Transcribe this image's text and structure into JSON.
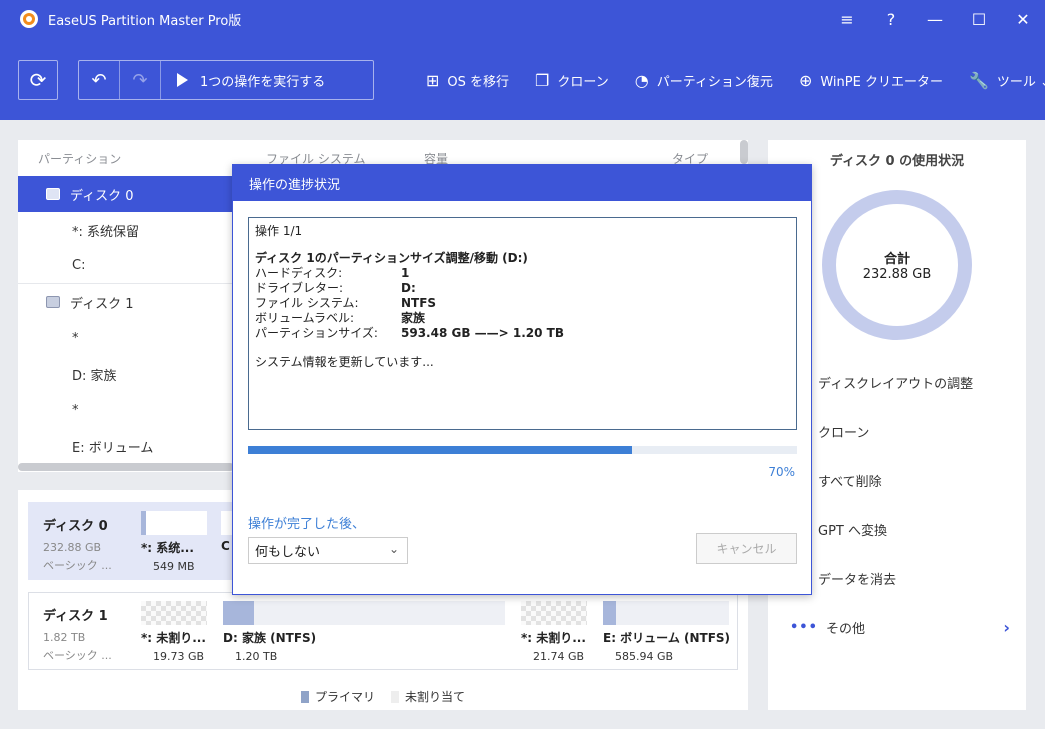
{
  "app": {
    "title": "EaseUS Partition Master Pro版"
  },
  "window_controls": {
    "menu": "≡",
    "help": "?",
    "minimize": "—",
    "maximize": "☐",
    "close": "✕"
  },
  "toolbar": {
    "refresh_icon": "⟳",
    "undo_icon": "↶",
    "redo_icon": "↷",
    "run_label": "1つの操作を実行する",
    "items": [
      {
        "icon": "windows-icon",
        "glyph": "⊞",
        "label": "OS を移行"
      },
      {
        "icon": "clone-icon",
        "glyph": "❐",
        "label": "クローン"
      },
      {
        "icon": "pie-recover-icon",
        "glyph": "◔",
        "label": "パーティション復元"
      },
      {
        "icon": "winpe-plus-icon",
        "glyph": "⊕",
        "label": "WinPE クリエーター"
      },
      {
        "icon": "tools-icon",
        "glyph": "🔧",
        "label": "ツール ⌄"
      }
    ]
  },
  "partition_list": {
    "headers": {
      "partition": "パーティション",
      "filesystem": "ファイル システム",
      "capacity": "容量",
      "type": "タイプ"
    },
    "rows": [
      {
        "label": "ディスク 0",
        "kind": "disk"
      },
      {
        "label": "*: 系统保留",
        "kind": "part"
      },
      {
        "label": "C:",
        "kind": "part"
      },
      {
        "label": "ディスク 1",
        "kind": "disk"
      },
      {
        "label": "*",
        "kind": "part"
      },
      {
        "label": "D: 家族",
        "kind": "part"
      },
      {
        "label": "*",
        "kind": "part"
      },
      {
        "label": "E: ボリューム",
        "kind": "part"
      }
    ]
  },
  "disk_map": {
    "disk0": {
      "name": "ディスク 0",
      "size": "232.88 GB",
      "type": "ベーシック ...",
      "partitions": [
        {
          "label": "*: 系统...",
          "size": "549 MB",
          "fill": 0.08
        },
        {
          "label": "C",
          "size": "",
          "fill": 0.0
        }
      ]
    },
    "disk1": {
      "name": "ディスク 1",
      "size": "1.82 TB",
      "type": "ベーシック ...",
      "partitions": [
        {
          "label": "*: 未割り...",
          "size": "19.73 GB",
          "unallocated": true
        },
        {
          "label": "D: 家族 (NTFS)",
          "size": "1.20 TB",
          "fill": 0.11
        },
        {
          "label": "*: 未割り...",
          "size": "21.74 GB",
          "unallocated": true
        },
        {
          "label": "E: ボリューム (NTFS)",
          "size": "585.94 GB",
          "fill": 0.1
        }
      ]
    },
    "legend": {
      "primary": "プライマリ",
      "unallocated": "未割り当て",
      "primary_color": "#8fa3c8"
    }
  },
  "right_panel": {
    "title": "ディスク 0 の使用状況",
    "total_label": "合計",
    "total_value": "232.88 GB",
    "actions": [
      "ディスクレイアウトの調整",
      "クローン",
      "すべて削除",
      "GPT へ変換",
      "データを消去"
    ],
    "more": "その他",
    "more_dots": "•••",
    "more_chevron": "›"
  },
  "dialog": {
    "title": "操作の進捗状況",
    "op_counter": "操作 1/1",
    "op_title": "ディスク 1のパーティションサイズ調整/移動 (D:)",
    "details": [
      {
        "k": "ハードディスク:",
        "v": "1"
      },
      {
        "k": "ドライブレター:",
        "v": "D:"
      },
      {
        "k": "ファイル システム:",
        "v": "NTFS"
      },
      {
        "k": "ボリュームラベル:",
        "v": "家族"
      },
      {
        "k": "パーティションサイズ:",
        "v": "593.48 GB ——> 1.20 TB"
      }
    ],
    "status": "システム情報を更新しています...",
    "progress": 0.7,
    "progress_text": "70%",
    "after_label": "操作が完了した後、",
    "after_select_value": "何もしない",
    "cancel_label": "キャンセル",
    "accent": "#3d7fd6"
  }
}
